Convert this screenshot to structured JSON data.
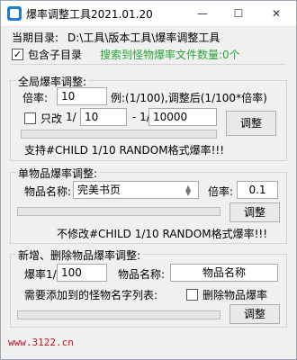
{
  "window": {
    "title": "爆率调整工具2021.01.20",
    "controls": {
      "minimize": "—",
      "maximize": "☐",
      "close": "✕"
    }
  },
  "dir_group": {
    "current_dir_label": "当期目录:",
    "current_dir_value": "D:\\工具\\版本工具\\爆率调整工具",
    "include_subdirs_label": "包含子目录",
    "include_subdirs_checked": true,
    "search_result": "搜索到怪物爆率文件数量:0个"
  },
  "global_group": {
    "legend": "全局爆率调整:",
    "rate_label": "倍率:",
    "rate_value": "10",
    "example_text": "例:(1/100),调整后(1/100*倍率)",
    "only_change_label": "只改",
    "only_change_checked": false,
    "prefix": "1/",
    "from_value": "10",
    "dash": "- 1/",
    "to_value": "10000",
    "adjust_button": "调整",
    "progress_percent": 0,
    "note": "支持#CHILD 1/10 RANDOM格式爆率!!!"
  },
  "item_group": {
    "legend": "单物品爆率调整:",
    "item_name_label": "物品名称:",
    "item_name_value": "完美书页",
    "rate_label": "倍率:",
    "rate_value": "0.1",
    "adjust_button": "调整",
    "progress_percent": 0,
    "note": "不修改#CHILD 1/10 RANDOM格式爆率!!!"
  },
  "add_group": {
    "legend": "新增、删除物品爆率调整:",
    "rate_label": "爆率1/",
    "rate_value": "100",
    "item_name_label": "物品名称:",
    "item_name_placeholder": "物品名称",
    "monster_list_label": "需要添加到的怪物名字列表:",
    "delete_label": "删除物品爆率",
    "delete_checked": false,
    "adjust_button": "调整",
    "progress_percent": 0
  },
  "footer": {
    "site": "www.3122.cn"
  }
}
